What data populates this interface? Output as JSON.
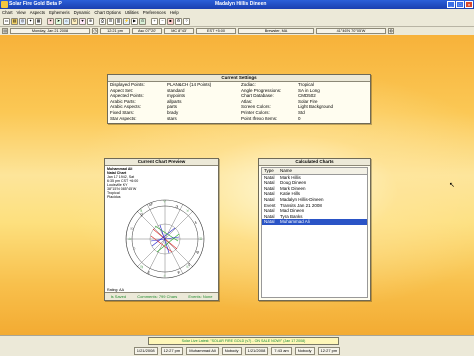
{
  "window": {
    "app_title": "Solar Fire Gold Beta P",
    "center_title": "Madalyn Hillis Dineen"
  },
  "menu": [
    "Chart",
    "View",
    "Aspects",
    "Ephemeris",
    "Dynamic",
    "Chart Options",
    "Utilities",
    "Preferences",
    "Help"
  ],
  "infobar": {
    "date": "Monday, Jan 21 2008",
    "time": "12:21 pm",
    "asc": "Asc 07°20'",
    "mc": "MC 8°43'",
    "zone": "EST +5:00",
    "city": "Brewster, MA",
    "coords": "41°46'N 70°05'W"
  },
  "settings": {
    "title": "Current Settings",
    "rows": [
      [
        "Displayed Points:",
        "PLAN&CH (14 Points)",
        "Zodiac:",
        "Tropical"
      ],
      [
        "Aspect Set:",
        "standard",
        "Angle Progressions:",
        "SA in Long"
      ],
      [
        "Aspected Points:",
        "mypoints",
        "Chart Database:",
        "CMD502"
      ],
      [
        "Arabic Parts:",
        "allparts",
        "Atlas:",
        "Solar Fire"
      ],
      [
        "Arabic Aspects:",
        "parts",
        "Screen Colors:",
        "Light Background"
      ],
      [
        "Fixed Stars:",
        "brady",
        "Printer Colors:",
        "Std"
      ],
      [
        "Star Aspects:",
        "stars",
        "Point Ifrexo Items:",
        "0"
      ]
    ]
  },
  "preview": {
    "title": "Current Chart Preview",
    "header_lines": [
      "Muhammad Ali",
      "Natal Chart",
      "Jan 17 1942, Sat",
      "6:35 pm CST +6:00",
      "Louisville KY",
      "38°15'N 085°45'W",
      "Tropical",
      "Placidus"
    ],
    "rating": "Rating: AA",
    "footer": [
      "Is Saved",
      "Comments: 799 Chars",
      "Events: None"
    ]
  },
  "calc": {
    "title": "Calculated Charts",
    "col_type": "Type",
    "col_name": "Name",
    "rows": [
      [
        "Natal",
        "Mark Hillis"
      ],
      [
        "Natal",
        "Doug Dineen"
      ],
      [
        "Natal",
        "Mark Dineen"
      ],
      [
        "Natal",
        "Katie Hills"
      ],
      [
        "Natal",
        "Madalyn Hillis-Dineen"
      ],
      [
        "Event",
        "Transits Jan 21 2008"
      ],
      [
        "Natal",
        "Mad Dineen"
      ],
      [
        "Natal",
        "Tyra Banks"
      ],
      [
        "Natal",
        "Muhammad Ali"
      ]
    ],
    "selected_index": 8
  },
  "status": {
    "ticker": "Solar Live Latest: \"SOLAR FIRE GOLD (v7) - ON SALE NOW!\" (Jan 17 2008)",
    "tasks": [
      "1/21/2008",
      "12:27 pm",
      "Muhammad Ali",
      "Nobody",
      "1/21/2008",
      "7:43 am",
      "Nobody",
      "12:27 pm"
    ]
  }
}
